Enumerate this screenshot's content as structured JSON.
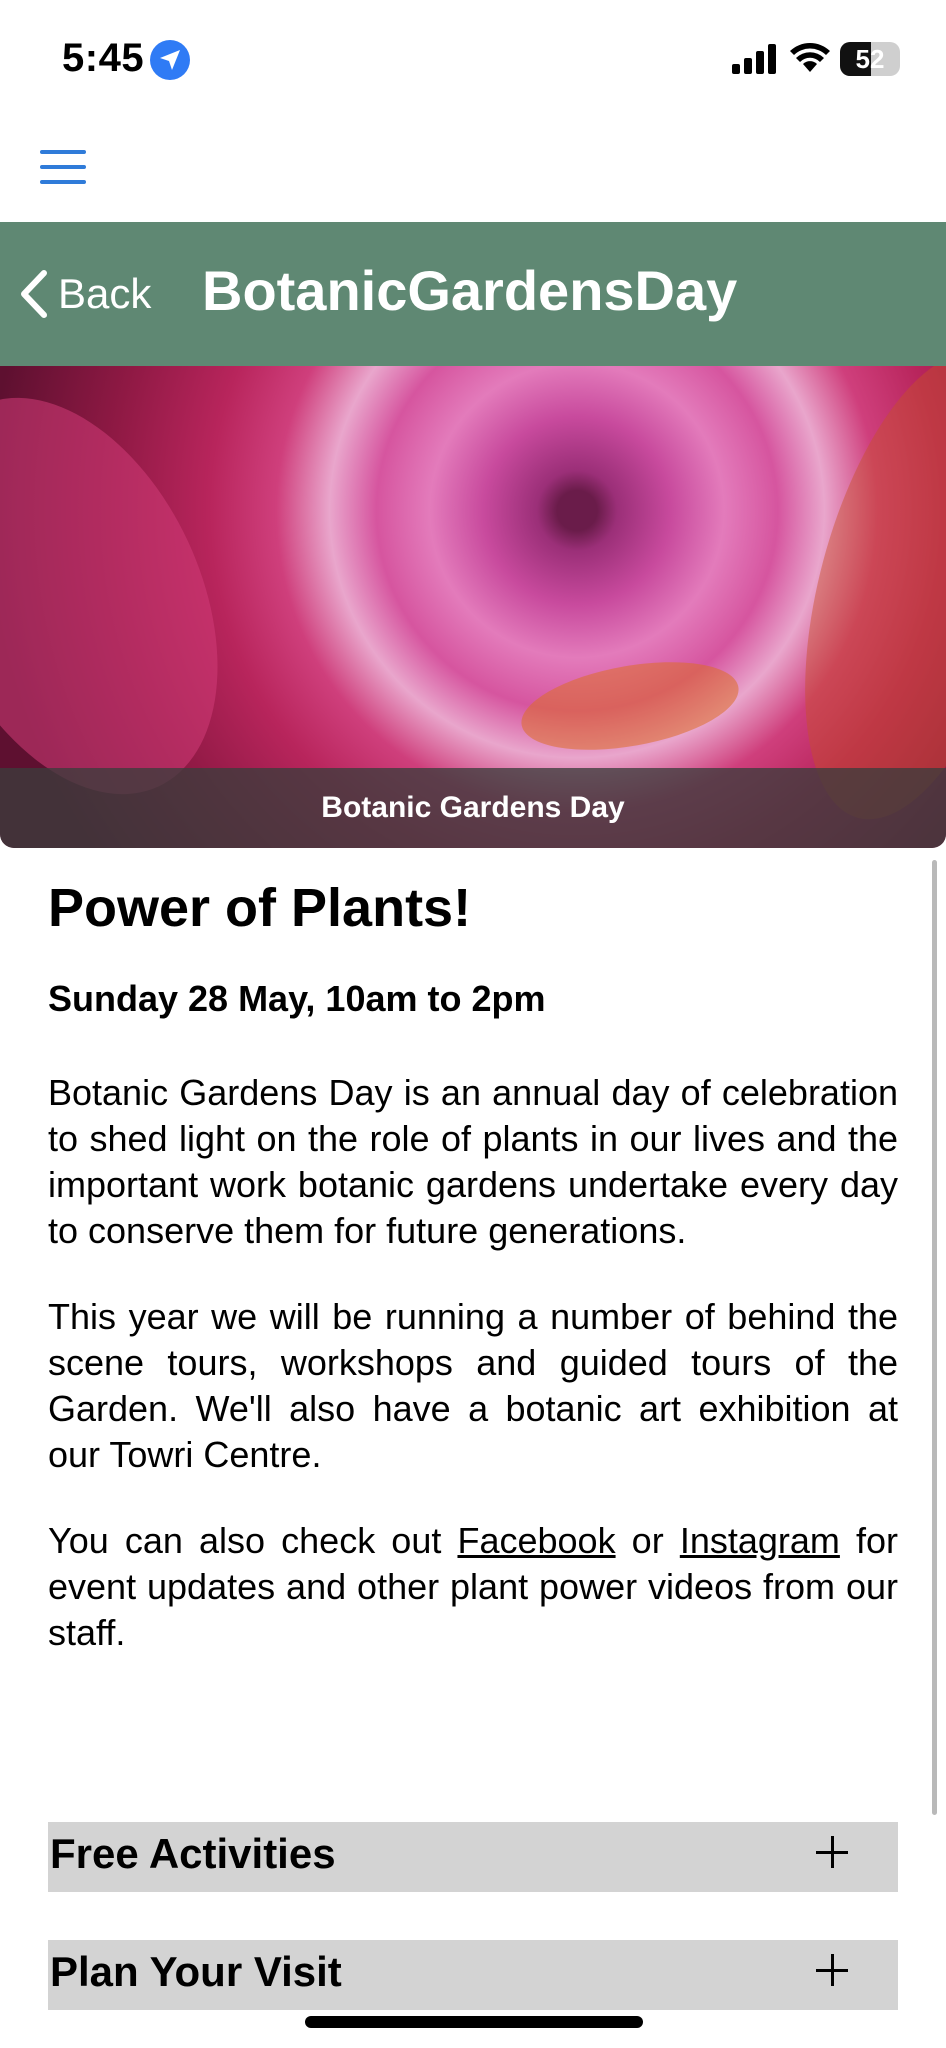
{
  "status_bar": {
    "time": "5:45",
    "battery": "52",
    "battery_level": 0.52
  },
  "nav": {
    "back_label": "Back",
    "title": "BotanicGardensDay"
  },
  "hero": {
    "caption": "Botanic Gardens Day"
  },
  "content": {
    "heading": "Power of Plants!",
    "date": "Sunday 28 May, 10am to 2pm",
    "para1": "Botanic Gardens Day is an annual day of celebration to shed light on the role of plants in our lives and the important work botanic gardens undertake every day to conserve them for future generations.",
    "para2": "This year we will be running a number of behind the scene tours, workshops and guided tours of the Garden. We'll also have a botanic art exhibition at our Towri Centre.",
    "para3_prefix": "You can also check out ",
    "facebook_link": "Facebook",
    "para3_or": " or ",
    "instagram_link": "Instagram",
    "para3_suffix": " for event updates and other plant power videos from our staff."
  },
  "accordions": [
    {
      "label": "Free Activities",
      "expanded": false
    },
    {
      "label": "Plan Your Visit",
      "expanded": false
    }
  ],
  "colors": {
    "nav_bg": "#5f8873",
    "accent": "#2f7bd9",
    "accordion_bg": "#d3d3d3"
  },
  "icons": [
    "location-arrow-icon",
    "signal-icon",
    "wifi-icon",
    "battery-icon",
    "hamburger-menu-icon",
    "chevron-left-icon",
    "plus-icon"
  ]
}
